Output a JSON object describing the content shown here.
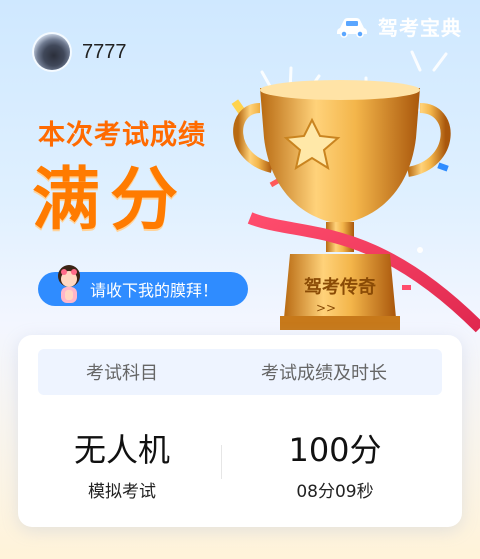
{
  "brand": {
    "name": "驾考宝典"
  },
  "user": {
    "name": "7777"
  },
  "hero": {
    "headline": "本次考试成绩",
    "result": "满分",
    "pill_text": "请收下我的膜拜！",
    "trophy_label": "驾考传奇"
  },
  "panel": {
    "head_left": "考试科目",
    "head_right": "考试成绩及时长",
    "subject": "无人机",
    "subject_type": "模拟考试",
    "score": "100分",
    "duration": "08分09秒"
  },
  "colors": {
    "accent_orange": "#ff7b00",
    "pill_blue": "#2f8cff",
    "gold": "#f3b54a"
  }
}
